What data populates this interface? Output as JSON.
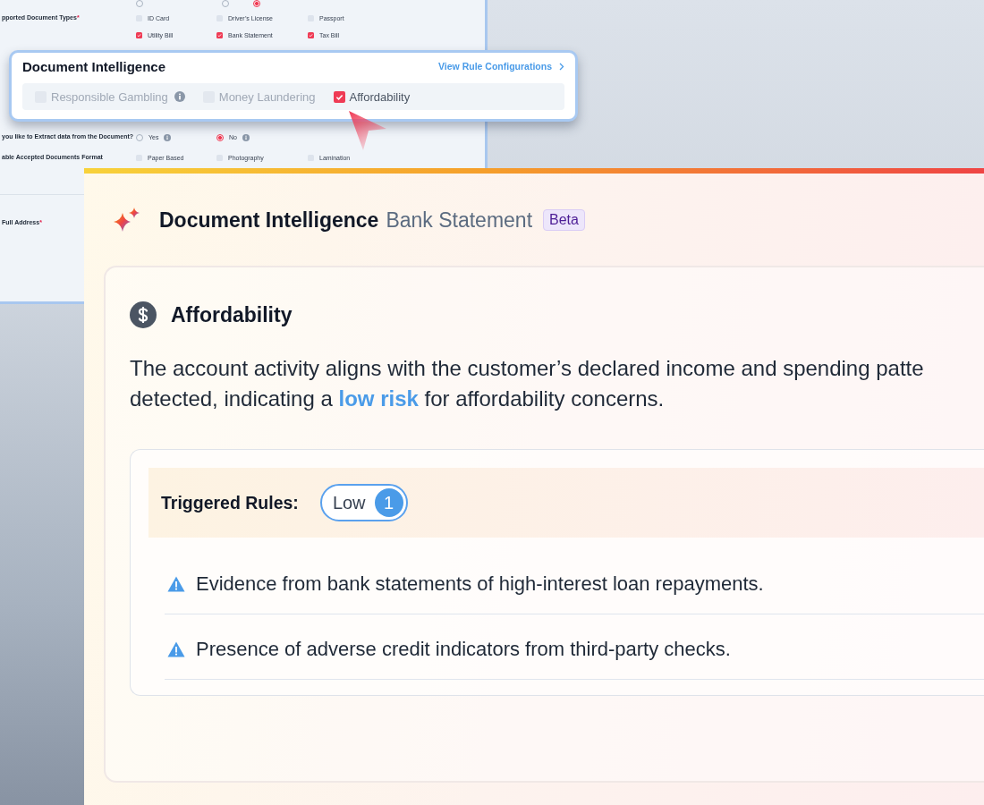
{
  "background_form": {
    "top_options": [
      {
        "selected": false
      },
      {
        "selected": false
      },
      {
        "selected": true
      }
    ],
    "rows": [
      {
        "kind": "checkbox",
        "label": "pported Document Types",
        "required_mark": "*",
        "options": [
          {
            "label": "ID Card",
            "checked": false
          },
          {
            "label": "Driver’s License",
            "checked": false
          },
          {
            "label": "Passport",
            "checked": false
          },
          {
            "label": "Utility Bill",
            "checked": true
          },
          {
            "label": "Bank Statement",
            "checked": true
          },
          {
            "label": "Tax Bill",
            "checked": true
          }
        ]
      },
      {
        "kind": "radio",
        "label": "you like to Extract data from the Document?",
        "options": [
          {
            "label": "Yes",
            "selected": false,
            "info": true
          },
          {
            "label": "No",
            "selected": true,
            "info": true
          }
        ]
      },
      {
        "kind": "checkbox",
        "label": "able Accepted Documents Format",
        "options": [
          {
            "label": "Paper Based",
            "checked": false
          },
          {
            "label": "Photography",
            "checked": false
          },
          {
            "label": "Lamination",
            "checked": false
          }
        ]
      }
    ],
    "address": {
      "label": "Full Address",
      "required_mark": "*"
    }
  },
  "popup": {
    "title": "Document Intelligence",
    "link": "View Rule Configurations",
    "options": [
      {
        "label": "Responsible Gambling",
        "checked": false,
        "info": true
      },
      {
        "label": "Money Laundering",
        "checked": false,
        "info": false
      },
      {
        "label": "Affordability",
        "checked": true,
        "info": false
      }
    ]
  },
  "card": {
    "title": "Document Intelligence",
    "subtitle": "Bank Statement",
    "badge": "Beta",
    "section": {
      "title": "Affordability",
      "summary": "The account activity aligns with the customer’s declared income and spending patte detected, indicating a **low risk** for affordability concerns.",
      "triggered": {
        "label": "Triggered Rules:",
        "level": "Low",
        "count": "1"
      },
      "rules": [
        "Evidence from bank statements of high-interest loan repayments.",
        "Presence of adverse credit indicators from third-party checks."
      ]
    }
  }
}
